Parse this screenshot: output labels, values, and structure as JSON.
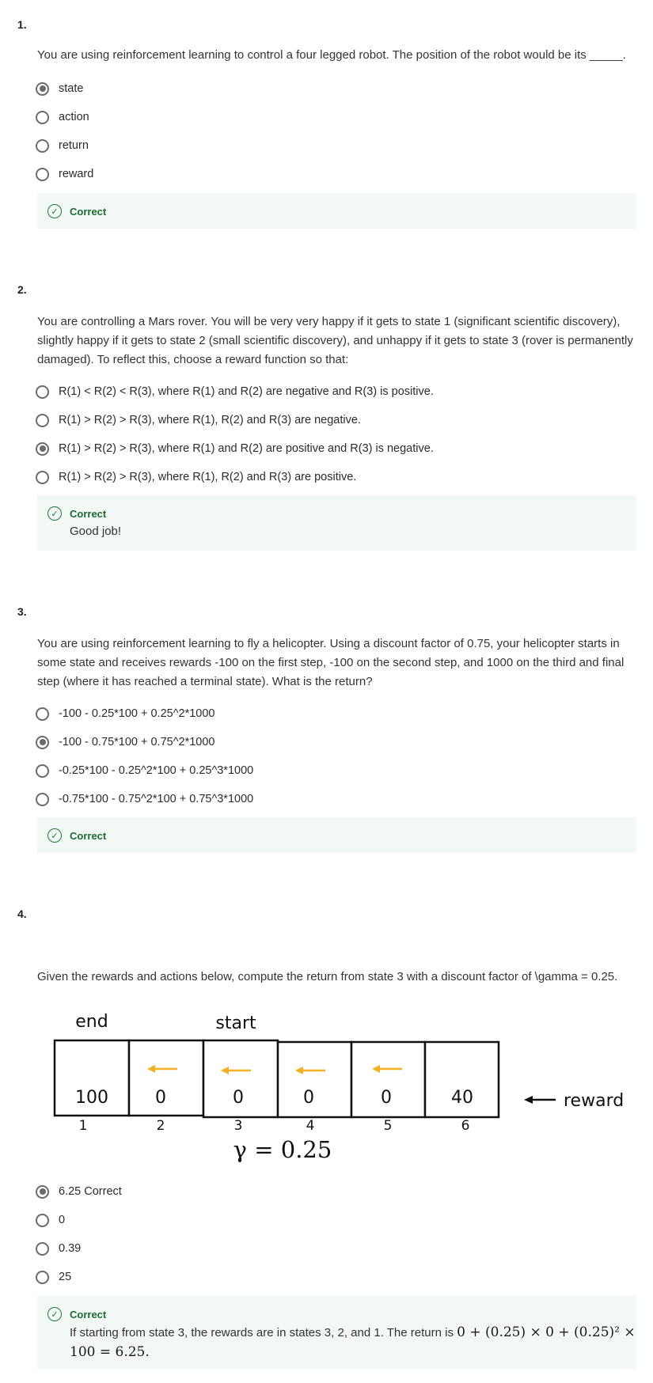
{
  "questions": [
    {
      "number": "1.",
      "text": "You are using reinforcement learning to control a four legged robot. The position of the robot would be its _____.",
      "options": [
        {
          "label": "state",
          "selected": true
        },
        {
          "label": "action",
          "selected": false
        },
        {
          "label": "return",
          "selected": false
        },
        {
          "label": "reward",
          "selected": false
        }
      ],
      "feedback": {
        "title": "Correct",
        "text": ""
      }
    },
    {
      "number": "2.",
      "text": "You are controlling a Mars rover. You will be very very happy if it gets to state 1 (significant scientific discovery), slightly happy if it gets to state 2 (small scientific discovery), and unhappy if it gets to state 3 (rover is permanently damaged). To reflect this, choose a reward function so that:",
      "options": [
        {
          "label": "R(1) < R(2) < R(3), where R(1) and R(2) are negative and R(3) is positive.",
          "selected": false
        },
        {
          "label": "R(1) > R(2) > R(3), where R(1), R(2) and R(3) are negative.",
          "selected": false
        },
        {
          "label": "R(1) > R(2) > R(3), where R(1) and R(2) are positive and R(3) is negative.",
          "selected": true
        },
        {
          "label": "R(1) > R(2) > R(3), where R(1), R(2) and R(3) are positive.",
          "selected": false
        }
      ],
      "feedback": {
        "title": "Correct",
        "text": "Good job!"
      }
    },
    {
      "number": "3.",
      "text": "You are using reinforcement learning to fly a helicopter. Using a discount factor of 0.75, your helicopter starts in some state and receives rewards -100 on the first step, -100 on the second step, and 1000 on the third and final step (where it has reached a terminal state). What is the return?",
      "options": [
        {
          "label": "-100 - 0.25*100 + 0.25^2*1000",
          "selected": false
        },
        {
          "label": "-100 - 0.75*100 + 0.75^2*1000",
          "selected": true
        },
        {
          "label": "-0.25*100 - 0.25^2*100 + 0.25^3*1000",
          "selected": false
        },
        {
          "label": "-0.75*100 - 0.75^2*100 + 0.75^3*1000",
          "selected": false
        }
      ],
      "feedback": {
        "title": "Correct",
        "text": ""
      }
    },
    {
      "number": "4.",
      "text": "Given the rewards and actions below, compute the return from state 3 with a discount factor of \\gamma = 0.25.",
      "diagram": {
        "end_label": "end",
        "start_label": "start",
        "rewards": [
          "100",
          "0",
          "0",
          "0",
          "0",
          "40"
        ],
        "states": [
          "1",
          "2",
          "3",
          "4",
          "5",
          "6"
        ],
        "reward_label": "reward",
        "gamma_label": "γ = 0.25",
        "arrow_color": "#f5b121"
      },
      "options": [
        {
          "label": "6.25 Correct",
          "selected": true
        },
        {
          "label": "0",
          "selected": false
        },
        {
          "label": "0.39",
          "selected": false
        },
        {
          "label": "25",
          "selected": false
        }
      ],
      "feedback": {
        "title": "Correct",
        "text_prefix": "If starting from state 3, the rewards are in states 3, 2, and 1. The return is ",
        "math_line1": "0 + (0.25) × 0 + (0.25)² ×",
        "math_line2": "100 = 6.25."
      }
    }
  ]
}
